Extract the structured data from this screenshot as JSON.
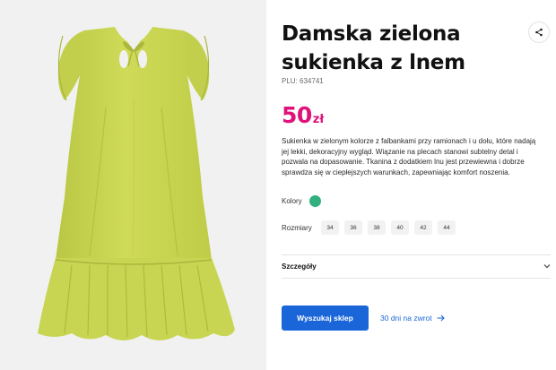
{
  "product": {
    "title": "Damska zielona sukienka z lnem",
    "plu_label": "PLU:",
    "plu_value": "634741",
    "price_amount": "50",
    "price_currency": "zł",
    "description": "Sukienka w zielonym kolorze z falbankami przy ramionach i u dołu, które nadają jej lekki, dekoracyjny wygląd. Wiązanie na plecach stanowi subtelny detal i pozwala na dopasowanie. Tkanina z dodatkiem lnu jest przewiewna i dobrze sprawdza się w ciepłejszych warunkach, zapewniając komfort noszenia.",
    "image_alt_icon": "dress-image",
    "dress_color": "#c9d650"
  },
  "share": {
    "icon": "share-icon"
  },
  "colors": {
    "label": "Kolory",
    "swatches": [
      "#33b07f"
    ]
  },
  "sizes": {
    "label": "Rozmiary",
    "options": [
      "34",
      "36",
      "38",
      "40",
      "42",
      "44"
    ]
  },
  "details": {
    "label": "Szczegóły",
    "icon": "chevron-down-icon"
  },
  "actions": {
    "primary_label": "Wyszukaj sklep",
    "primary_color": "#1a66d9",
    "returns_label": "30 dni na zwrot",
    "returns_icon": "arrow-right-icon"
  },
  "accent": {
    "price_color": "#e0127a"
  }
}
